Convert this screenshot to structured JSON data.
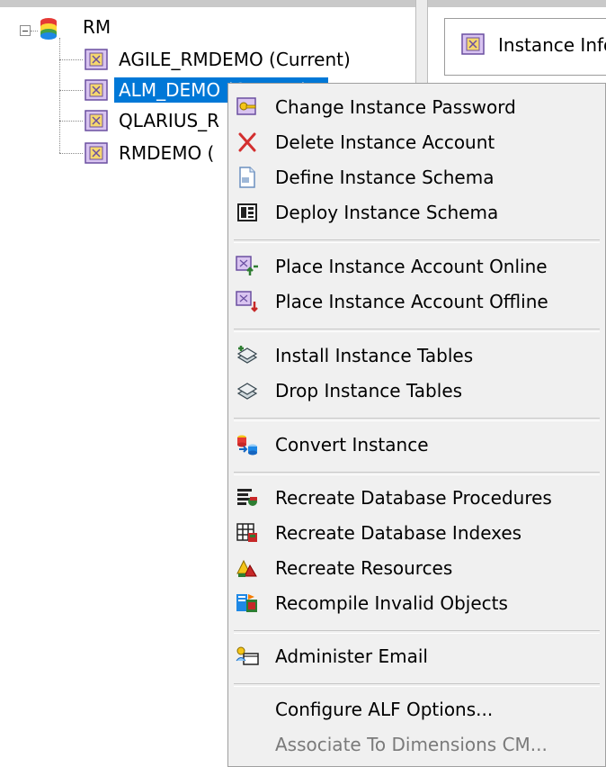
{
  "tree": {
    "root_label": "RM",
    "items": [
      {
        "label": "AGILE_RMDEMO (Current)"
      },
      {
        "label": "ALM_DEMO (Current)",
        "selected": true
      },
      {
        "label": "QLARIUS_R"
      },
      {
        "label": "RMDEMO ("
      }
    ]
  },
  "right_panel": {
    "tab_label": "Instance Info"
  },
  "context_menu": {
    "items": [
      {
        "label": "Change Instance Password",
        "icon": "key-instance-icon"
      },
      {
        "label": "Delete Instance Account",
        "icon": "red-x-icon"
      },
      {
        "label": "Define Instance Schema",
        "icon": "document-icon"
      },
      {
        "label": "Deploy Instance Schema",
        "icon": "schema-deploy-icon"
      },
      {
        "label": "Place Instance Account Online",
        "icon": "online-icon"
      },
      {
        "label": "Place Instance Account Offline",
        "icon": "offline-icon"
      },
      {
        "label": "Install Instance Tables",
        "icon": "install-tables-icon"
      },
      {
        "label": "Drop Instance Tables",
        "icon": "drop-tables-icon"
      },
      {
        "label": "Convert Instance",
        "icon": "convert-icon"
      },
      {
        "label": "Recreate Database Procedures",
        "icon": "procedures-icon"
      },
      {
        "label": "Recreate Database Indexes",
        "icon": "indexes-icon"
      },
      {
        "label": "Recreate Resources",
        "icon": "resources-icon"
      },
      {
        "label": "Recompile Invalid Objects",
        "icon": "recompile-icon"
      },
      {
        "label": "Administer Email",
        "icon": "email-icon"
      },
      {
        "label": "Configure ALF Options...",
        "icon": ""
      },
      {
        "label": "Associate To Dimensions CM...",
        "icon": "",
        "disabled": true
      }
    ]
  },
  "colors": {
    "selection": "#0078d7",
    "menu_background": "#f0f0f0",
    "disabled_text": "#7a7a7a"
  }
}
